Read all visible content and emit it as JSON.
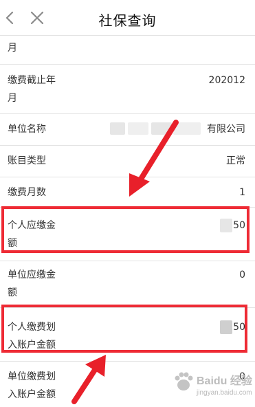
{
  "header": {
    "title": "社保查询"
  },
  "rows": {
    "partial": {
      "label": "月"
    },
    "end_month": {
      "label_line1": "缴费截止年",
      "label_line2": "月",
      "value": "202012"
    },
    "unit_name": {
      "label": "单位名称",
      "value": "有限公司"
    },
    "account_type": {
      "label": "账目类型",
      "value": "正常"
    },
    "months": {
      "label": "缴费月数",
      "value": "1"
    },
    "personal_due": {
      "label_line1": "个人应缴金",
      "label_line2": "额",
      "value": "50"
    },
    "unit_due": {
      "label_line1": "单位应缴金",
      "label_line2": "额",
      "value": "0"
    },
    "personal_transfer": {
      "label_line1": "个人缴费划",
      "label_line2": "入账户金额",
      "value": "50"
    },
    "unit_transfer": {
      "label_line1": "单位缴费划",
      "label_line2": "入账户金额",
      "value": "0"
    }
  },
  "watermark": {
    "text": "Baidu 经验",
    "sub": "jingyan.baidu.com"
  },
  "colors": {
    "highlight": "#ee2b35",
    "arrow": "#e8202a"
  }
}
